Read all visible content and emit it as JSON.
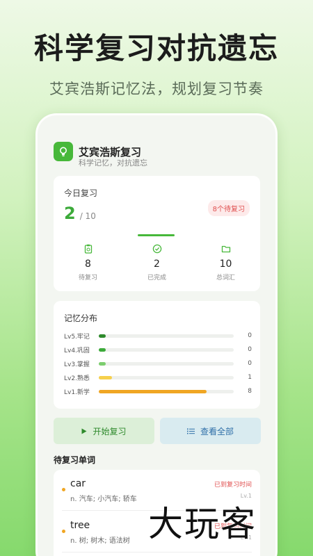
{
  "promo": {
    "headline": "科学复习对抗遗忘",
    "subline": "艾宾浩斯记忆法，规划复习节奏"
  },
  "app": {
    "title": "艾宾浩斯复习",
    "subtitle": "科学记忆，对抗遗忘",
    "logo_icon": "lightbulb-icon",
    "accent": "#47b83a"
  },
  "today": {
    "label": "今日复习",
    "done": "2",
    "total": "/ 10",
    "badge": "8个待复习",
    "stats": [
      {
        "icon": "clipboard-icon",
        "value": "8",
        "label": "待复习"
      },
      {
        "icon": "check-circle-icon",
        "value": "2",
        "label": "已完成"
      },
      {
        "icon": "folder-icon",
        "value": "10",
        "label": "总词汇"
      }
    ]
  },
  "memory": {
    "title": "记忆分布",
    "levels": [
      {
        "label": "Lv5.牢记",
        "count": "0",
        "fill": 0.05,
        "color": "#2e8a2c"
      },
      {
        "label": "Lv4.巩固",
        "count": "0",
        "fill": 0.05,
        "color": "#3caa3a"
      },
      {
        "label": "Lv3.掌握",
        "count": "0",
        "fill": 0.05,
        "color": "#7ccd6e"
      },
      {
        "label": "Lv2.熟悉",
        "count": "1",
        "fill": 0.1,
        "color": "#f6d04d"
      },
      {
        "label": "Lv1.新学",
        "count": "8",
        "fill": 0.8,
        "color": "#f0a623"
      }
    ]
  },
  "actions": {
    "start": "开始复习",
    "view_all": "查看全部"
  },
  "pending": {
    "title": "待复习单词",
    "words": [
      {
        "word": "car",
        "meaning": "n. 汽车; 小汽车; 轿车",
        "status": "已到复习时间",
        "level": "Lv.1"
      },
      {
        "word": "tree",
        "meaning": "n. 树; 树木; 语法树",
        "status": "已到复习时间",
        "level": "Lv.1"
      }
    ]
  },
  "watermark": "大玩客"
}
